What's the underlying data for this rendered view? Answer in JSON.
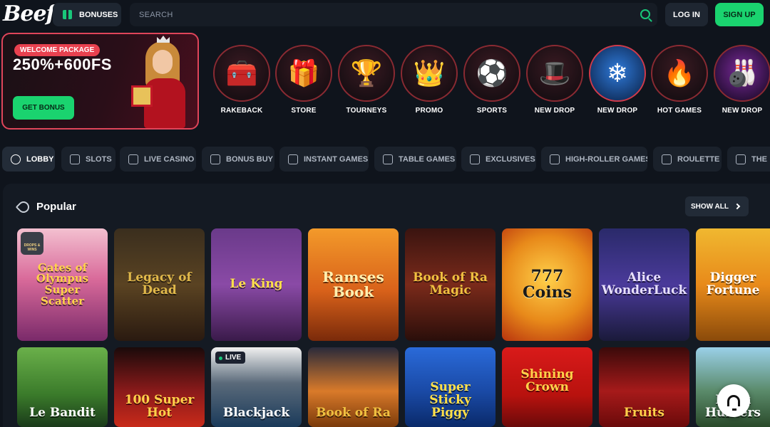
{
  "header": {
    "logo": "Beef",
    "bonuses_label": "BONUSES",
    "search_placeholder": "SEARCH",
    "login_label": "LOG IN",
    "signup_label": "SIGN UP"
  },
  "promo": {
    "badge": "WELCOME PACKAGE",
    "headline": "250%+600FS",
    "button": "GET BONUS"
  },
  "categories": [
    {
      "label": "RAKEBACK",
      "icon": "treasure-chest-icon",
      "glyph": "🧰"
    },
    {
      "label": "STORE",
      "icon": "chest-icon",
      "glyph": "🎁"
    },
    {
      "label": "TOURNEYS",
      "icon": "trophy-icon",
      "glyph": "🏆"
    },
    {
      "label": "PROMO",
      "icon": "crown-icon",
      "glyph": "👑"
    },
    {
      "label": "SPORTS",
      "icon": "soccer-ball-icon",
      "glyph": "⚽"
    },
    {
      "label": "NEW DROP",
      "icon": "game-art-icon",
      "glyph": "🎩"
    },
    {
      "label": "NEW DROP",
      "icon": "snow-party-icon",
      "glyph": "❄"
    },
    {
      "label": "HOT GAMES",
      "icon": "fire-icon",
      "glyph": "🔥"
    },
    {
      "label": "NEW DROP",
      "icon": "perfect-strike-icon",
      "glyph": "🎳"
    }
  ],
  "tabs": [
    {
      "label": "LOBBY",
      "icon": "lobby-icon",
      "active": true
    },
    {
      "label": "SLOTS",
      "icon": "slots-icon"
    },
    {
      "label": "LIVE CASINO",
      "icon": "live-casino-icon"
    },
    {
      "label": "BONUS BUY",
      "icon": "bonus-buy-icon"
    },
    {
      "label": "INSTANT GAMES",
      "icon": "instant-games-icon"
    },
    {
      "label": "TABLE GAMES",
      "icon": "table-games-icon"
    },
    {
      "label": "EXCLUSIVES",
      "icon": "star-icon"
    },
    {
      "label": "HIGH-ROLLER GAMES",
      "icon": "dollar-icon"
    },
    {
      "label": "ROULETTE",
      "icon": "roulette-icon"
    },
    {
      "label": "THE",
      "icon": "the-icon"
    }
  ],
  "section": {
    "title": "Popular",
    "show_all": "SHOW ALL"
  },
  "games_row1": [
    {
      "title": "Gates of Olympus Super Scatter",
      "badge": "DROPS & WINS"
    },
    {
      "title": "Legacy of Dead"
    },
    {
      "title": "Le King"
    },
    {
      "title": "Ramses Book"
    },
    {
      "title": "Book of Ra Magic"
    },
    {
      "title": "777 Coins"
    },
    {
      "title": "Alice WonderLuck"
    },
    {
      "title": "Digger Fortune"
    }
  ],
  "games_row2": [
    {
      "title": "Le Bandit"
    },
    {
      "title": "100 Super Hot"
    },
    {
      "title": "Blackjack",
      "badge": "LIVE"
    },
    {
      "title": "Book of Ra"
    },
    {
      "title": "Super Sticky Piggy"
    },
    {
      "title": "Shining Crown"
    },
    {
      "title": "Fruits"
    },
    {
      "title": "Duck Hunters"
    }
  ],
  "colors": {
    "accent_green": "#1ad36f",
    "promo_red": "#e8414f",
    "bg": "#0f141c"
  }
}
